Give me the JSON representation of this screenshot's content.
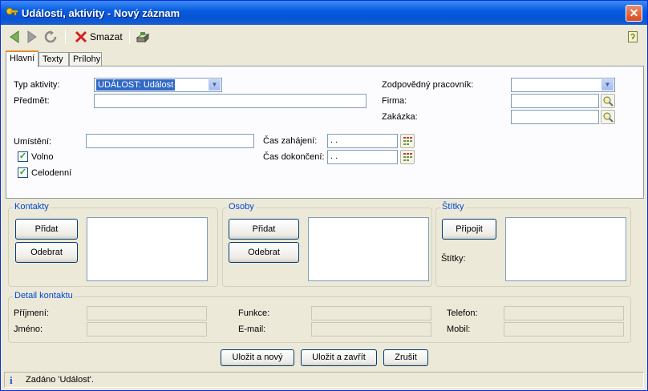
{
  "window": {
    "title": "Události, aktivity - Nový záznam"
  },
  "toolbar": {
    "delete_label": "Smazat"
  },
  "tabs": [
    {
      "label": "Hlavní"
    },
    {
      "label": "Texty"
    },
    {
      "label": "Prílohy"
    }
  ],
  "form": {
    "typ_label": "Typ aktivity:",
    "typ_value": "UDÁLOST: Událost",
    "predmet_label": "Předmět:",
    "predmet_value": "",
    "umisteni_label": "Umístění:",
    "umisteni_value": "",
    "volno_label": "Volno",
    "volno_checked": true,
    "celodenni_label": "Celodenní",
    "celodenni_checked": true,
    "cas_zahajeni_label": "Čas zahájení:",
    "cas_zahajeni_value": " .  .",
    "cas_dokonceni_label": "Čas dokončení:",
    "cas_dokonceni_value": " .  .",
    "pracovnik_label": "Zodpovědný pracovník:",
    "pracovnik_value": "",
    "firma_label": "Firma:",
    "firma_value": "",
    "zakazka_label": "Zakázka:",
    "zakazka_value": ""
  },
  "kontakty": {
    "title": "Kontakty",
    "add_label": "Přidat",
    "remove_label": "Odebrat"
  },
  "osoby": {
    "title": "Osoby",
    "add_label": "Přidat",
    "remove_label": "Odebrat"
  },
  "stitky": {
    "title": "Štítky",
    "attach_label": "Připojit",
    "label": "Štítky:"
  },
  "detail": {
    "title": "Detail kontaktu",
    "prijmeni_label": "Příjmení:",
    "jmeno_label": "Jméno:",
    "funkce_label": "Funkce:",
    "email_label": "E-mail:",
    "telefon_label": "Telefon:",
    "mobil_label": "Mobil:"
  },
  "buttons": {
    "save_new": "Uložit a nový",
    "save_close": "Uložit a zavřít",
    "cancel": "Zrušit"
  },
  "status": {
    "text": "Zadáno 'Událost'."
  }
}
